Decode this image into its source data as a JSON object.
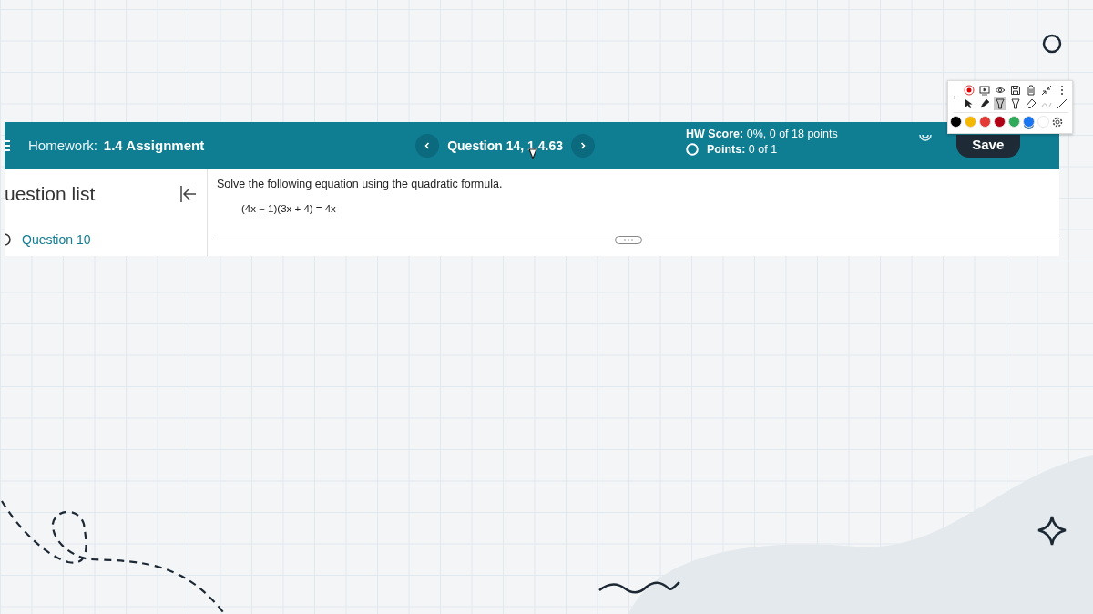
{
  "header": {
    "label": "Homework:",
    "title": "1.4 Assignment",
    "question": "Question 14, 1.4.63",
    "score": "**HW Score:** 0%, 0 of 18 points",
    "points": "**Points:** 0 of 1",
    "save": "Save"
  },
  "sidebar": {
    "heading": "uestion list",
    "items": [
      {
        "label": "Question 10"
      }
    ]
  },
  "question": {
    "prompt": "Solve the following equation using the quadratic formula.",
    "equation": "(4x − 1)(3x + 4) = 4x"
  },
  "toolbar": {
    "colors": [
      {
        "color": "#000000",
        "selected": false
      },
      {
        "color": "#f5b800",
        "selected": false
      },
      {
        "color": "#e53935",
        "selected": false
      },
      {
        "color": "#b00015",
        "selected": false
      },
      {
        "color": "#2eaa5a",
        "selected": false
      },
      {
        "color": "#1976f0",
        "selected": true
      },
      {
        "color": "#ffffff",
        "selected": false
      }
    ]
  }
}
